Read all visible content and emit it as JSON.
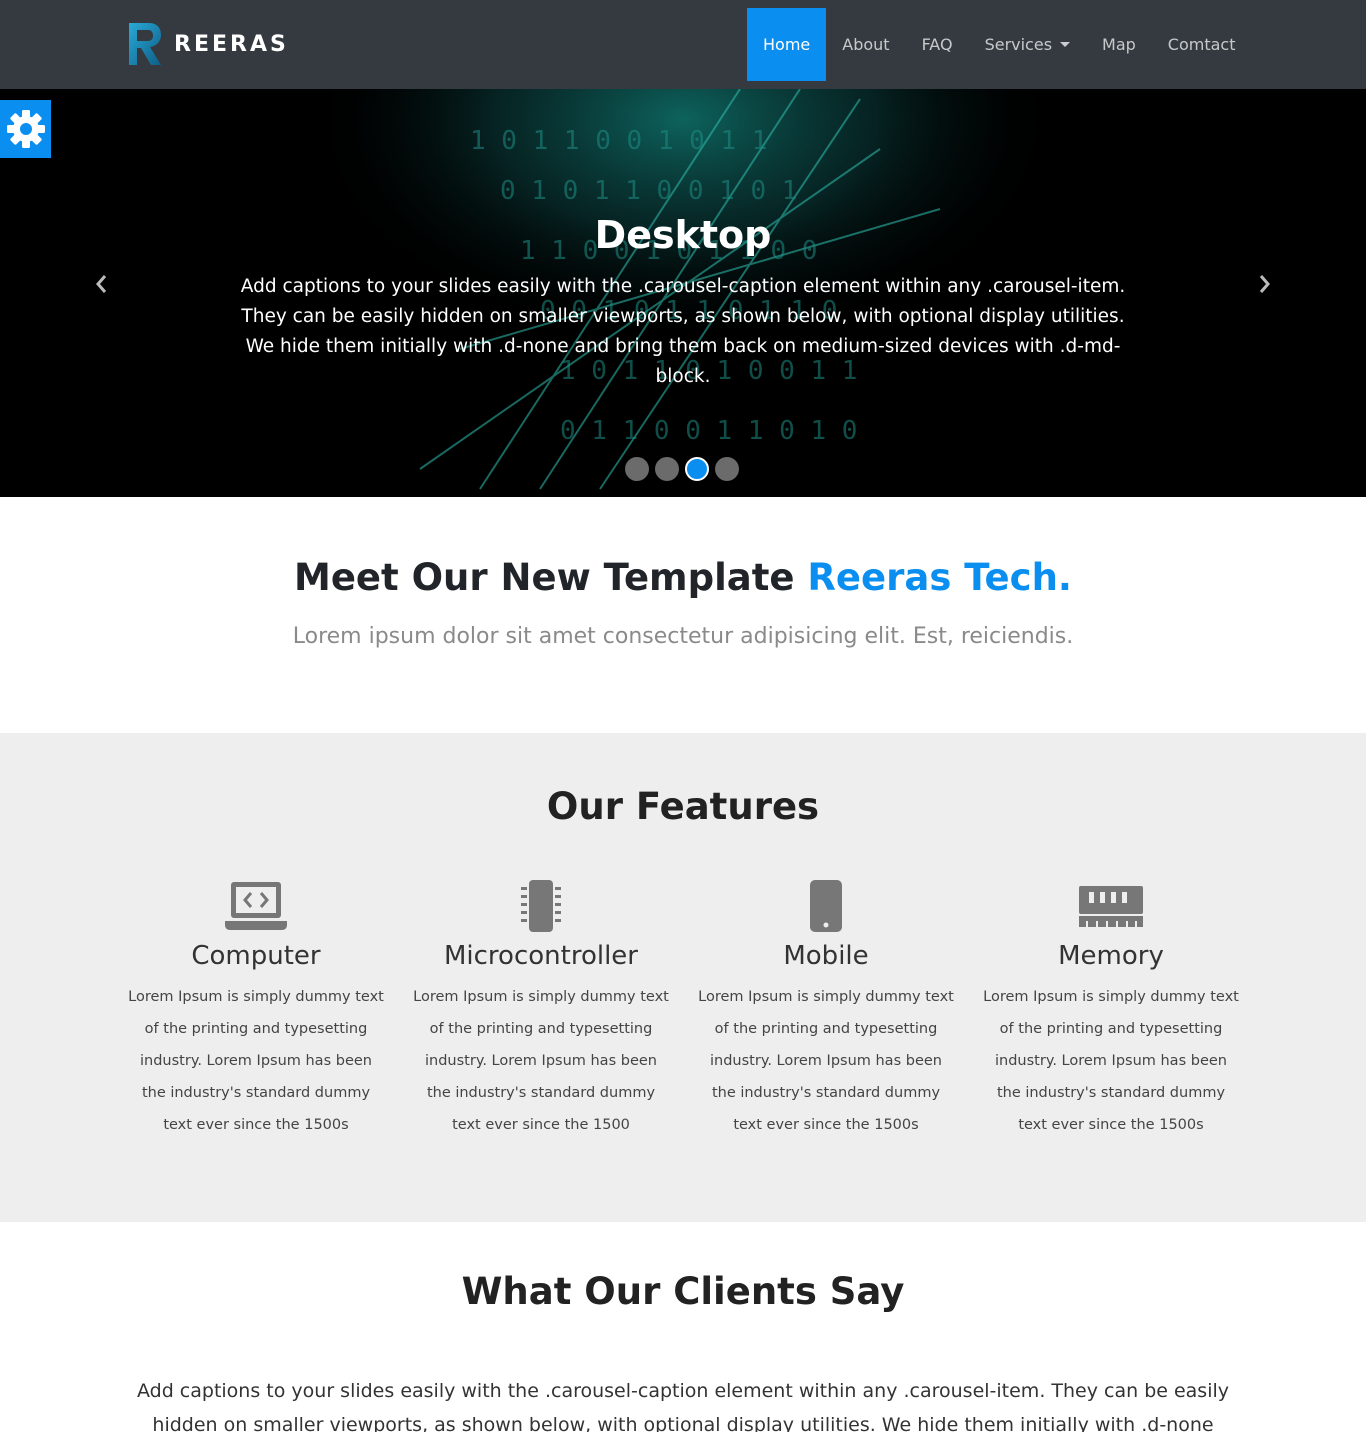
{
  "brand": {
    "name": "REERAS"
  },
  "nav": {
    "home": "Home",
    "about": "About",
    "faq": "FAQ",
    "services": "Services",
    "map": "Map",
    "contact": "Comtact"
  },
  "hero": {
    "title": "Desktop",
    "text": "Add captions to your slides easily with the .carousel-caption element within any .carousel-item. They can be easily hidden on smaller viewports, as shown below, with optional display utilities. We hide them initially with .d-none and bring them back on medium-sized devices with .d-md-block.",
    "active_indicator": 3,
    "indicator_count": 4
  },
  "settings": {
    "icon": "gear-icon"
  },
  "intro": {
    "title_main": "Meet Our New Template ",
    "title_accent": "Reeras Tech.",
    "subtitle": "Lorem ipsum dolor sit amet consectetur adipisicing elit. Est, reiciendis."
  },
  "features": {
    "title": "Our Features",
    "items": [
      {
        "icon": "laptop-code-icon",
        "title": "Computer",
        "text": "Lorem Ipsum is simply dummy text of the printing and typesetting industry. Lorem Ipsum has been the industry's standard dummy text ever since the 1500s"
      },
      {
        "icon": "microchip-icon",
        "title": "Microcontroller",
        "text": "Lorem Ipsum is simply dummy text of the printing and typesetting industry. Lorem Ipsum has been the industry's standard dummy text ever since the 1500"
      },
      {
        "icon": "mobile-icon",
        "title": "Mobile",
        "text": "Lorem Ipsum is simply dummy text of the printing and typesetting industry. Lorem Ipsum has been the industry's standard dummy text ever since the 1500s"
      },
      {
        "icon": "memory-icon",
        "title": "Memory",
        "text": "Lorem Ipsum is simply dummy text of the printing and typesetting industry. Lorem Ipsum has been the industry's standard dummy text ever since the 1500s"
      }
    ]
  },
  "clients": {
    "title": "What Our Clients Say",
    "text": "Add captions to your slides easily with the .carousel-caption element within any .carousel-item. They can be easily hidden on smaller viewports, as shown below, with optional display utilities. We hide them initially with .d-none and bring them"
  },
  "colors": {
    "accent": "#0a8ff0",
    "navbar": "#343a40",
    "features_bg": "#eeeeee"
  }
}
